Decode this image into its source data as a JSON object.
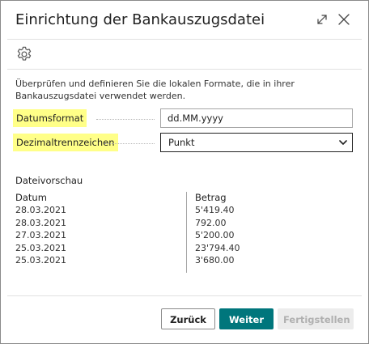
{
  "dialog": {
    "title": "Einrichtung der Bankauszugsdatei"
  },
  "instruction": "Überprüfen und definieren Sie die lokalen Formate, die in ihrer Bankauszugsdatei verwendet werden.",
  "fields": {
    "date_format": {
      "label": "Datumsformat",
      "value": "dd.MM.yyyy"
    },
    "decimal_separator": {
      "label": "Dezimaltrennzeichen",
      "selected": "Punkt"
    }
  },
  "preview": {
    "title": "Dateivorschau",
    "columns": [
      "Datum",
      "Betrag"
    ],
    "rows": [
      [
        "28.03.2021",
        "5'419.40"
      ],
      [
        "28.03.2021",
        "792.00"
      ],
      [
        "27.03.2021",
        "5'200.00"
      ],
      [
        "25.03.2021",
        "23'794.40"
      ],
      [
        "25.03.2021",
        "3'680.00"
      ]
    ]
  },
  "buttons": {
    "back": "Zurück",
    "next": "Weiter",
    "finish": "Fertigstellen"
  },
  "colors": {
    "primary": "#00767c",
    "label_highlight": "#ffff88",
    "disabled_bg": "#ececec",
    "disabled_text": "#b0b0b0"
  },
  "icons": {
    "expand": "expand-icon",
    "close": "close-icon",
    "settings": "gear-icon",
    "select": "chevron-down-icon"
  }
}
